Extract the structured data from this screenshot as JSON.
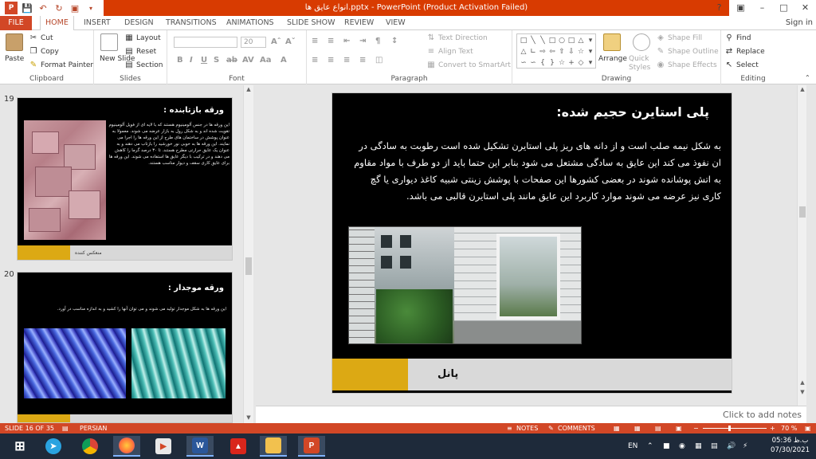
{
  "window": {
    "title": "انواع عایق ها.pptx - PowerPoint (Product Activation Failed)",
    "sign_in": "Sign in"
  },
  "tabs": [
    {
      "label": "FILE"
    },
    {
      "label": "HOME"
    },
    {
      "label": "INSERT"
    },
    {
      "label": "DESIGN"
    },
    {
      "label": "TRANSITIONS"
    },
    {
      "label": "ANIMATIONS"
    },
    {
      "label": "SLIDE SHOW"
    },
    {
      "label": "REVIEW"
    },
    {
      "label": "VIEW"
    }
  ],
  "ribbon": {
    "clipboard": {
      "paste": "Paste",
      "cut": "Cut",
      "copy": "Copy",
      "format_painter": "Format Painter",
      "label": "Clipboard"
    },
    "slides": {
      "new_slide": "New Slide",
      "layout": "Layout",
      "reset": "Reset",
      "section": "Section",
      "label": "Slides"
    },
    "font": {
      "size": "20",
      "label": "Font"
    },
    "paragraph": {
      "text_direction": "Text Direction",
      "align_text": "Align Text",
      "convert_smartart": "Convert to SmartArt",
      "label": "Paragraph"
    },
    "drawing": {
      "arrange": "Arrange",
      "quick_styles": "Quick Styles",
      "shape_fill": "Shape Fill",
      "shape_outline": "Shape Outline",
      "shape_effects": "Shape Effects",
      "label": "Drawing"
    },
    "editing": {
      "find": "Find",
      "replace": "Replace",
      "select": "Select",
      "label": "Editing"
    }
  },
  "thumbnails": [
    {
      "number": "19",
      "title": "ورقه بازتابنده :",
      "text": "این ورقه ها در جنس آلومینیوم هستند که با لایه ای از فویل آلومینیوم تقویت شده اند و به شکل رول به بازار عرضه می شوند. معمولا به عنوان پوشش در ساختمان های طرح از این ورقه ها را اجرا می نمایند. این ورقه ها به خوبی نور خورشید را بازتاب می دهند و به عنوان یک عایق حرارتی مطرح هستند. تا ۳۰ درصد گرما را کاهش می دهند و در ترکیب با دیگر عایق ها استفاده می شوند. این ورقه ها برای عایق کاری سقف و دیوار مناسب هستند.",
      "footer": "منعکس کننده"
    },
    {
      "number": "20",
      "title": "ورقه موجدار :",
      "text": "این ورقه ها به شکل موجدار تولید می شوند و می توان آنها را کشید و به اندازه مناسب در آورد.",
      "footer": ""
    }
  ],
  "slide": {
    "title": "پلی استایرن حجیم شده:",
    "body": "به شکل نیمه صلب است و از دانه های ریز پلی استایرن تشکیل شده است رطوبت به سادگی در ان نفوذ می کند این عایق به سادگی مشتعل می شود بنابر این حتما باید از دو طرف با مواد مقاوم به اتش پوشانده شوند در بعضی کشورها این صفحات با پوشش زینتی شبیه کاغذ دیواری یا گچ کاری نیز عرضه می شوند موارد کاربرد این عایق مانند پلی استایرن قالبی می باشد.",
    "footer_label": "پانل"
  },
  "notes_placeholder": "Click to add notes",
  "status": {
    "slide_counter": "SLIDE 16 OF 35",
    "language": "PERSIAN",
    "notes": "NOTES",
    "comments": "COMMENTS",
    "zoom": "70 %"
  },
  "taskbar": {
    "lang": "EN",
    "time": "05:36 ب.ظ",
    "date": "07/30/2021"
  },
  "colors": {
    "accent": "#d24726",
    "title_bar": "#d83b01",
    "gold": "#dca914"
  }
}
